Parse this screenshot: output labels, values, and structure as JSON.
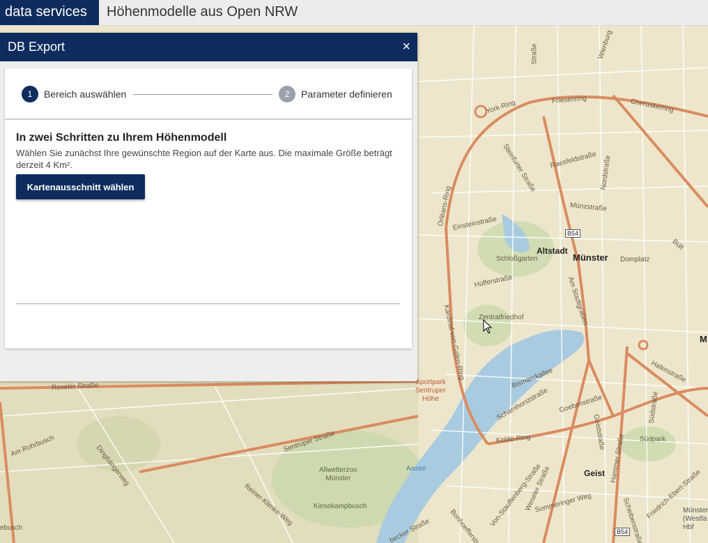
{
  "header": {
    "brand": "data services",
    "title": "Höhenmodelle aus Open NRW"
  },
  "dialog": {
    "title": "DB Export",
    "close_icon": "×",
    "steps": [
      {
        "number": "1",
        "label": "Bereich auswählen",
        "state": "active"
      },
      {
        "number": "2",
        "label": "Parameter definieren",
        "state": "inactive"
      }
    ],
    "heading": "In zwei Schritten zu Ihrem Höhenmodell",
    "description": "Wählen Sie zunächst Ihre gewünschte Region auf der Karte aus. Die maximale Größe beträgt derzeit 4 Km².",
    "button_label": "Kartenausschnitt wählen"
  },
  "map": {
    "labels": {
      "altstadt": "Altstadt",
      "muenster": "Münster",
      "geist": "Geist",
      "schlossgarten": "Schloßgarten",
      "domplatz": "Domplatz",
      "zentralfriedhof": "Zentralfriedhof",
      "aasee": "Aasee",
      "suedpark": "Südpark",
      "allwetterzoo": "Allwetterzoo\nMünster",
      "kiesekampbusch": "Kiesekampbusch",
      "sportpark": "Sportpark\nSentruper\nHöhe",
      "york_ring": "York-Ring",
      "friesenring": "Friesenring",
      "cheruskerring": "Cheruskerring",
      "raesfeldstrasse": "Raesfeldstraße",
      "nordstrasse": "Nordstraße",
      "steinfurter": "Steinfurter Straße",
      "orleans_ring": "Orléans-Ring",
      "einsteinstrasse": "Einsteinstraße",
      "muenzstrasse": "Münzstraße",
      "hufferstrasse": "Hüfferstraße",
      "am_stadtgraben": "Am Stadtgraben",
      "kardinal": "Kardinal-von-Galen-Ring",
      "bismarckallee": "Bismarckallee",
      "scharnhorststrasse": "Scharnhorststraße",
      "goebenstrasse": "Goebenstraße",
      "geiststrasse": "Geiststraße",
      "kolde_ring": "Kolde-Ring",
      "hafenstrasse": "Hafenstraße",
      "suedstrasse": "Südstraße",
      "hammer_strasse": "Hammer Straße",
      "weseler_strasse": "Weseler Straße",
      "stauffenberg": "Von-Stauffenberg-Straße",
      "sentruper": "Sentruper Straße",
      "roxeler": "Roxeler Straße",
      "am_rohrbusch": "Am Rohrbusch",
      "dingbaengerweg": "Dingbängerweg",
      "reiner_klimke": "Reiner-Klimke-Weg",
      "mecklenbecker": "becker Straße",
      "bonhoeffer": "Bonhoefferstraße",
      "sommer_weg": "Sommeringer Weg",
      "schiebe": "Scheibenstraße",
      "friedrich_ebert": "Friedrich-Ebert-Straße",
      "bult": "Bült",
      "wienburg": "Wienburg",
      "strasse_top": "Straße",
      "muenster_hbf": "Münster\n(Westfa\nHbf",
      "m_edge": "M",
      "ebusch": "ebusch",
      "shield_b54": "B54",
      "shield_b54_2": "B54"
    }
  }
}
